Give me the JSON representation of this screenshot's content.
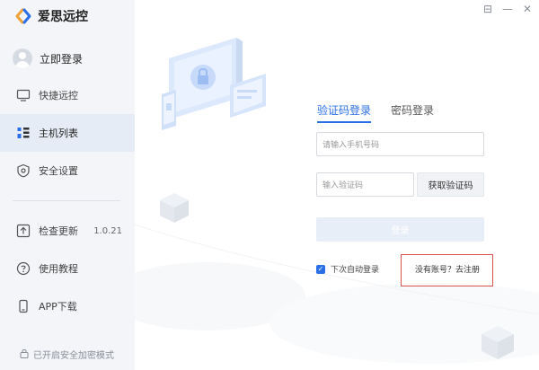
{
  "app": {
    "title": "爱思远控"
  },
  "user": {
    "login_label": "立即登录"
  },
  "nav": {
    "items": [
      {
        "label": "快捷远控",
        "icon": "monitor-icon"
      },
      {
        "label": "主机列表",
        "icon": "host-list-icon"
      },
      {
        "label": "安全设置",
        "icon": "shield-icon"
      }
    ],
    "bottom_items": [
      {
        "label": "检查更新",
        "icon": "update-icon",
        "version": "1.0.21"
      },
      {
        "label": "使用教程",
        "icon": "help-icon"
      },
      {
        "label": "APP下载",
        "icon": "phone-icon"
      }
    ],
    "security_note": "已开启安全加密模式"
  },
  "window_controls": {
    "pin": "⊟",
    "minimize": "—",
    "close": "✕"
  },
  "login": {
    "tabs": [
      "验证码登录",
      "密码登录"
    ],
    "phone_placeholder": "请输入手机号码",
    "code_placeholder": "输入验证码",
    "get_code_label": "获取验证码",
    "login_label": "登录",
    "remember_label": "下次自动登录",
    "register_label": "没有账号？去注册"
  },
  "colors": {
    "accent": "#2b6fe8",
    "sidebar_bg": "#f3f5f8",
    "highlight_box": "#d9534f"
  }
}
